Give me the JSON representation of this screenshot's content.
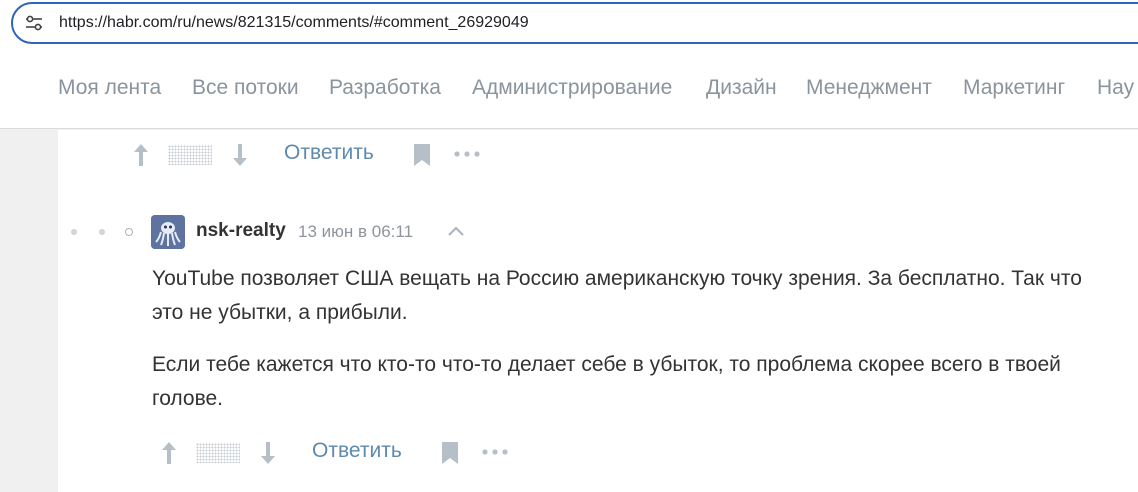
{
  "browser": {
    "url": "https://habr.com/ru/news/821315/comments/#comment_26929049"
  },
  "nav": {
    "items": [
      {
        "label": "Моя лента"
      },
      {
        "label": "Все потоки"
      },
      {
        "label": "Разработка"
      },
      {
        "label": "Администрирование"
      },
      {
        "label": "Дизайн"
      },
      {
        "label": "Менеджмент"
      },
      {
        "label": "Маркетинг"
      },
      {
        "label": "Нау"
      }
    ]
  },
  "comment_actions_top": {
    "reply_label": "Ответить"
  },
  "comment": {
    "author": "nsk-realty",
    "date": "13 июн в 06:11",
    "paragraphs": [
      "YouTube позволяет США вещать на Россию американскую точку зрения. За бесплатно. Так что это не убытки, а прибыли.",
      "Если тебе кажется что кто-то что-то делает себе в убыток, то проблема скорее всего в твоей голове."
    ],
    "reply_label": "Ответить"
  },
  "colors": {
    "accent": "#5e8aae",
    "address_border": "#2f64b8",
    "nav_text": "#8a949e",
    "body_text": "#333333"
  }
}
